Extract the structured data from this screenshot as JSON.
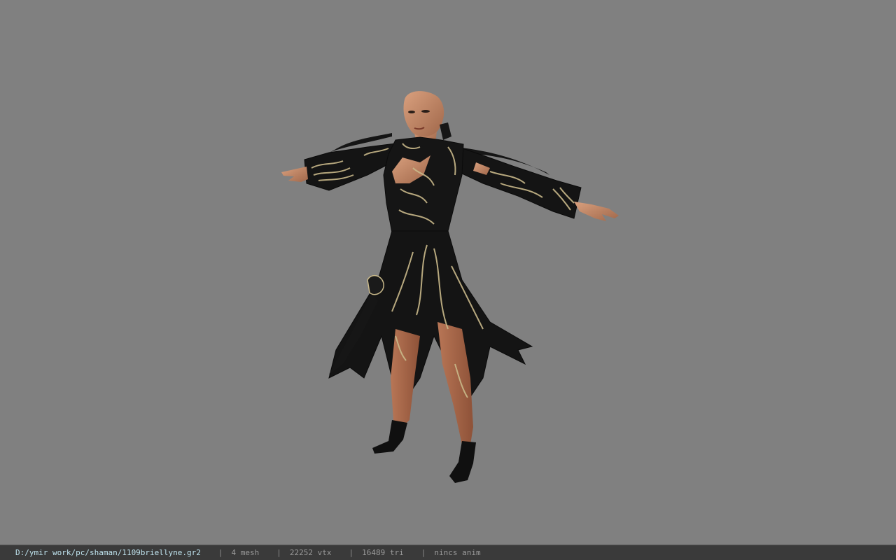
{
  "viewer": {
    "background_color": "#808080",
    "model_icon": "character-model"
  },
  "statusbar": {
    "file_path": "D:/ymir work/pc/shaman/1109briellyne.gr2",
    "separator": "|",
    "mesh_count": "4 mesh",
    "vertex_count": "22252 vtx",
    "triangle_count": "16489 tri",
    "animation": "nincs anim",
    "path_color": "#bfe3ee",
    "text_color": "#9a9a9a",
    "bar_color": "#3a3a3a"
  }
}
